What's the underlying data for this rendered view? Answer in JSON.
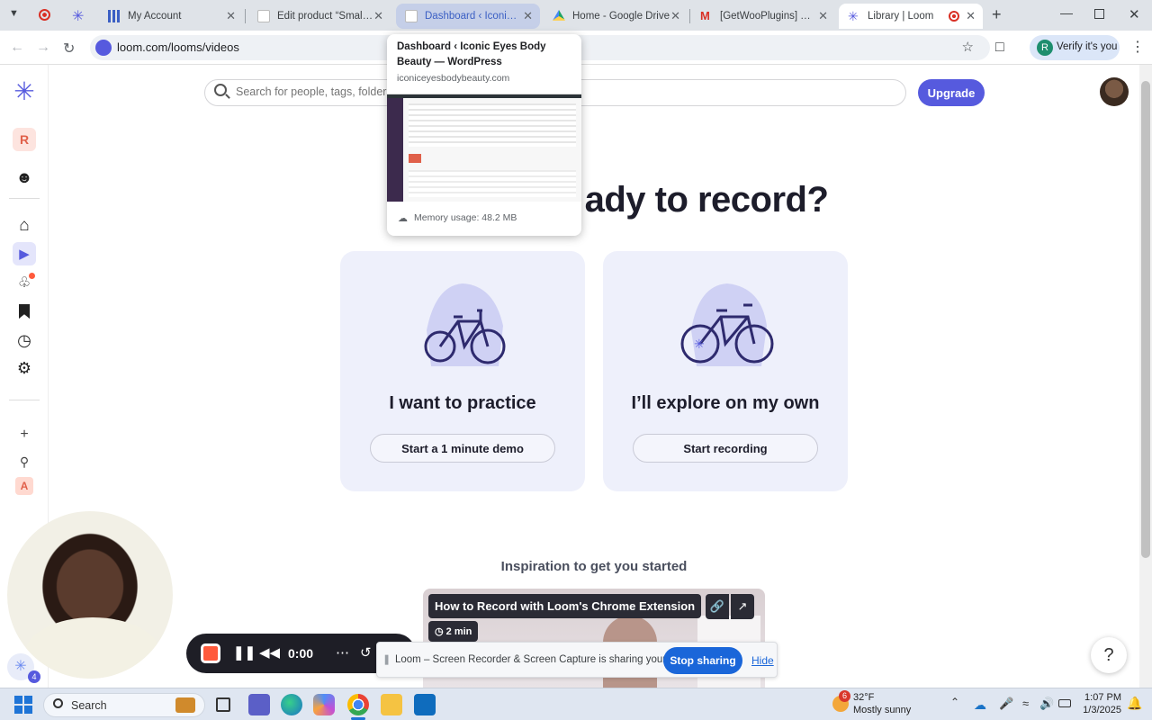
{
  "browser": {
    "tabs": [
      {
        "title": "My Account",
        "state": "normal"
      },
      {
        "title": "Edit product “Small Pig",
        "state": "normal"
      },
      {
        "title": "Dashboard ‹ Iconic Eyes",
        "state": "hovered"
      },
      {
        "title": "Home - Google Drive",
        "state": "normal"
      },
      {
        "title": "[GetWooPlugins] Ticket",
        "state": "normal"
      },
      {
        "title": "Library | Loom",
        "state": "active"
      }
    ],
    "url": "loom.com/looms/videos",
    "verify_label": "Verify it's you",
    "profile_initial": "R"
  },
  "hover_card": {
    "title": "Dashboard ‹ Iconic Eyes Body Beauty — WordPress",
    "domain": "iconiceyesbodybeauty.com",
    "memory": "Memory usage: 48.2 MB"
  },
  "sidebar": {
    "workspace_initial": "R",
    "bottom_initial": "A"
  },
  "main": {
    "search_placeholder": "Search for people, tags, folders, spaces, and Looms",
    "upgrade_label": "Upgrade",
    "heading": "ady to record?",
    "cards": [
      {
        "title": "I want to practice",
        "button": "Start a 1 minute demo"
      },
      {
        "title": "I’ll explore on my own",
        "button": "Start recording"
      }
    ],
    "inspiration_title": "Inspiration to get you started",
    "video": {
      "title": "How to Record with Loom's Chrome Extension",
      "duration": "2 min"
    }
  },
  "recorder": {
    "timer": "0:00",
    "share_text": "Loom – Screen Recorder & Screen Capture is sharing your screen.",
    "stop_sharing": "Stop sharing",
    "hide": "Hide",
    "badge_count": "4"
  },
  "help": {
    "label": "?"
  },
  "taskbar": {
    "search_label": "Search",
    "weather_temp": "32°F",
    "weather_desc": "Mostly sunny",
    "weather_badge": "6",
    "time": "1:07 PM",
    "date": "1/3/2025"
  },
  "colors": {
    "accent": "#565ade",
    "record_red": "#ff5a3c",
    "share_blue": "#1a66d9"
  }
}
